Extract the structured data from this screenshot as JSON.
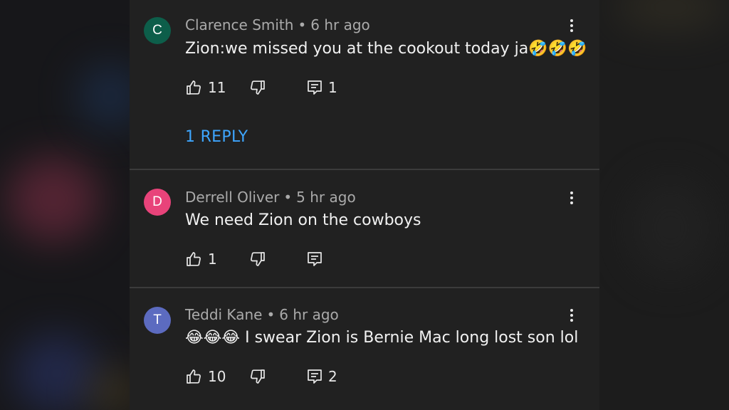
{
  "colors": {
    "panel_bg": "#212121",
    "meta_text": "#aaaaaa",
    "body_text": "#f1f1f1",
    "link": "#3ea6ff",
    "avatar_c": "#0d5e4a",
    "avatar_d": "#e8437a",
    "avatar_t": "#5c6bc0"
  },
  "comments": [
    {
      "avatar_letter": "C",
      "author": "Clarence Smith",
      "separator": "•",
      "time": "6 hr ago",
      "text": "Zion:we missed you at the cookout today ja🤣🤣🤣",
      "likes": "11",
      "replies_count": "1",
      "reply_link": "1 REPLY",
      "icons": [
        "thumbs-up-icon",
        "thumbs-down-icon",
        "reply-icon",
        "more-vert-icon"
      ]
    },
    {
      "avatar_letter": "D",
      "author": "Derrell Oliver",
      "separator": "•",
      "time": "5 hr ago",
      "text": "We need Zion on the cowboys",
      "likes": "1",
      "icons": [
        "thumbs-up-icon",
        "thumbs-down-icon",
        "reply-icon",
        "more-vert-icon"
      ]
    },
    {
      "avatar_letter": "T",
      "author": "Teddi Kane",
      "separator": "•",
      "time": "6 hr ago",
      "text": "😂😂😂 I swear Zion is Bernie Mac long lost son lol",
      "likes": "10",
      "replies_count": "2",
      "icons": [
        "thumbs-up-icon",
        "thumbs-down-icon",
        "reply-icon",
        "more-vert-icon"
      ]
    }
  ]
}
